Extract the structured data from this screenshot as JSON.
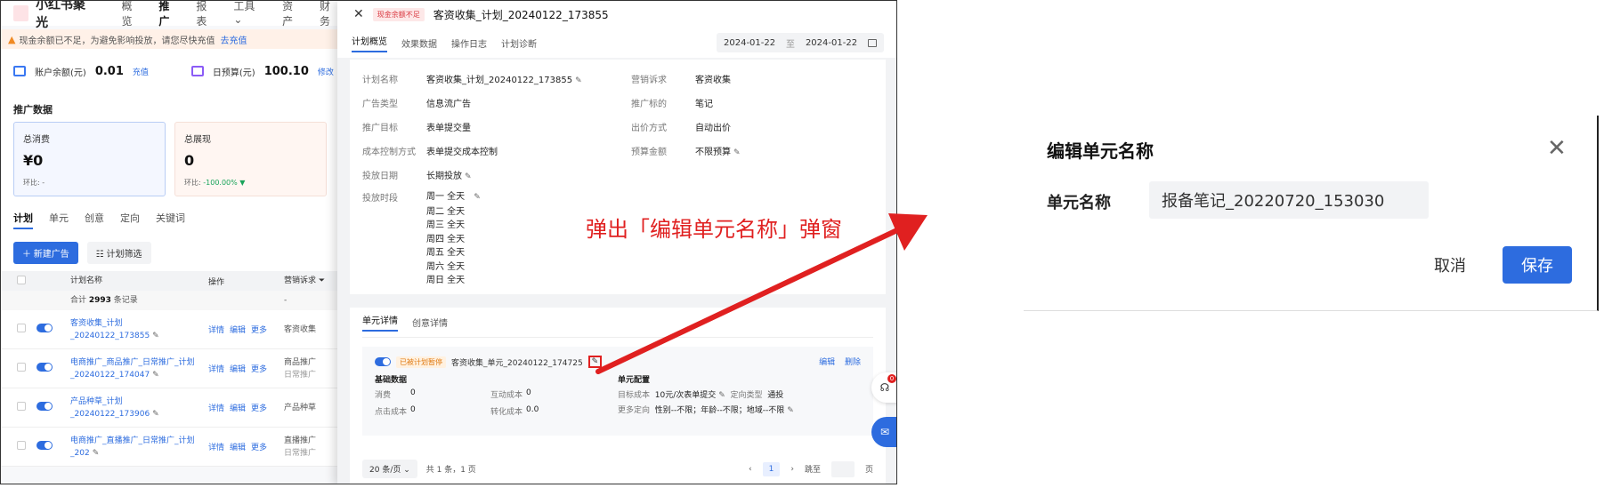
{
  "app": {
    "brand": "小红书聚光",
    "nav": [
      "概览",
      "推广",
      "报表",
      "工具 ⌄",
      "资产",
      "财务"
    ],
    "warning": {
      "text": "现金余额已不足，为避免影响投放，请您尽快充值",
      "link": "去充值"
    },
    "balance": {
      "label": "账户余额(元)",
      "value": "0.01",
      "link": "充值"
    },
    "budget": {
      "label": "日预算(元)",
      "value": "100.10",
      "link": "修改"
    },
    "section_title": "推广数据",
    "stats": [
      {
        "label": "总消费",
        "value": "¥0",
        "sub": "环比: -"
      },
      {
        "label": "总展现",
        "value": "0",
        "sub_prefix": "环比: ",
        "sub_value": "-100.00% ▼"
      }
    ],
    "tabs": [
      "计划",
      "单元",
      "创意",
      "定向",
      "关键词"
    ],
    "buttons": {
      "new_ad": "＋ 新建广告",
      "filter": "☷ 计划筛选"
    },
    "table": {
      "headers": {
        "name": "计划名称",
        "ops": "操作",
        "goal": "营销诉求 ⏷"
      },
      "summary": {
        "prefix": "合计 ",
        "count": "2993",
        "suffix": " 条记录",
        "goal": "-"
      },
      "ops": [
        "详情",
        "编辑",
        "更多"
      ],
      "rows": [
        {
          "name": "客资收集_计划_20240122_173855",
          "goal": "客资收集",
          "goal_sub": ""
        },
        {
          "name": "电商推广_商品推广_日常推广_计划_20240122_174047",
          "goal": "商品推广",
          "goal_sub": "日常推广"
        },
        {
          "name": "产品种草_计划_20240122_173906",
          "goal": "产品种草",
          "goal_sub": ""
        },
        {
          "name": "电商推广_直播推广_日常推广_计划_202",
          "goal": "直播推广",
          "goal_sub": "日常推广"
        }
      ]
    }
  },
  "drawer": {
    "badge": "现金余额不足",
    "title": "客资收集_计划_20240122_173855",
    "tabs": [
      "计划概览",
      "效果数据",
      "操作日志",
      "计划诊断"
    ],
    "date_start": "2024-01-22",
    "date_sep": "至",
    "date_end": "2024-01-22",
    "overview": {
      "rows": [
        {
          "l": "计划名称",
          "v": "客资收集_计划_20240122_173855",
          "l2": "营销诉求",
          "v2": "客资收集"
        },
        {
          "l": "广告类型",
          "v": "信息流广告",
          "l2": "推广标的",
          "v2": "笔记"
        },
        {
          "l": "推广目标",
          "v": "表单提交量",
          "l2": "出价方式",
          "v2": "自动出价"
        },
        {
          "l": "成本控制方式",
          "v": "表单提交成本控制",
          "l2": "预算金额",
          "v2": "不限预算"
        },
        {
          "l": "投放日期",
          "v": "长期投放",
          "l2": "",
          "v2": ""
        }
      ],
      "schedule_label": "投放时段",
      "schedule": [
        "周一  全天",
        "周二  全天",
        "周三  全天",
        "周四  全天",
        "周五  全天",
        "周六  全天",
        "周日  全天"
      ]
    },
    "unit": {
      "tabs": [
        "单元详情",
        "创意详情"
      ],
      "status": "已被计划暂停",
      "name": "客资收集_单元_20240122_174725",
      "ops": [
        "编辑",
        "删除"
      ],
      "basic_title": "基础数据",
      "metrics": [
        {
          "l": "消费",
          "v": "0"
        },
        {
          "l": "互动成本",
          "v": "0"
        },
        {
          "l": "点击成本",
          "v": "0"
        },
        {
          "l": "转化成本",
          "v": "0.0"
        }
      ],
      "config_title": "单元配置",
      "config": {
        "target_cost_label": "目标成本",
        "target_cost": "10元/次表单提交",
        "targeting_type_label": "定向类型",
        "targeting_type": "通投",
        "more_label": "更多定向",
        "more": "性别--不限；年龄--不限；地域--不限"
      }
    },
    "pager": {
      "size": "20 条/页 ⌄",
      "total": "共 1 条，1 页",
      "prev": "‹",
      "page": "1",
      "next": "›",
      "jump": "跳至",
      "unit": "页"
    },
    "float_notif": "0"
  },
  "annotation": "弹出「编辑单元名称」弹窗",
  "modal": {
    "title": "编辑单元名称",
    "label": "单元名称",
    "input_value": "报备笔记_20220720_153030",
    "cancel": "取消",
    "save": "保存"
  },
  "colors": {
    "accent": "#2d6cdf",
    "annotation": "#e02020",
    "warning_bg": "#fff1e8"
  },
  "icons": [
    "close-icon",
    "pencil-icon",
    "calendar-icon",
    "warning-icon",
    "toggle-icon",
    "filter-icon",
    "support-icon",
    "mail-icon"
  ]
}
